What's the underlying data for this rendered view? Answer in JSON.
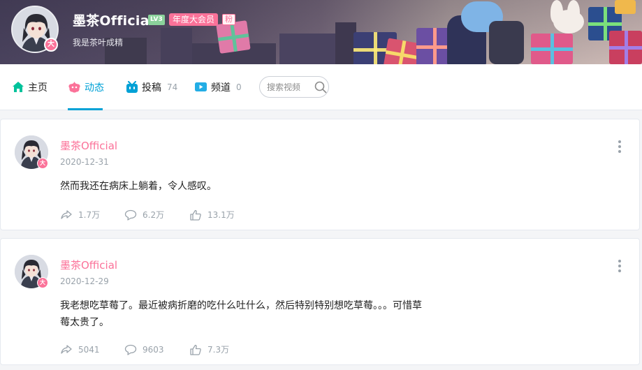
{
  "profile": {
    "name": "墨茶Official",
    "level": "LV3",
    "vip_label": "年度大会员",
    "fan_label": "粉",
    "sign": "我是茶叶成精",
    "avatar_badge": "大"
  },
  "nav": {
    "home": "主页",
    "dynamic": "动态",
    "posts": "投稿",
    "posts_count": "74",
    "channels": "频道",
    "channels_count": "0",
    "search_placeholder": "搜索视频"
  },
  "posts": [
    {
      "author": "墨茶Official",
      "date": "2020-12-31",
      "content": "然而我还在病床上躺着，令人感叹。",
      "share": "1.7万",
      "comment": "6.2万",
      "like": "13.1万"
    },
    {
      "author": "墨茶Official",
      "date": "2020-12-29",
      "content": "我老想吃草莓了。最近被病折磨的吃什么吐什么，然后特别特别想吃草莓。。。可惜草莓太贵了。",
      "share": "5041",
      "comment": "9603",
      "like": "7.3万"
    }
  ],
  "colors": {
    "brand_pink": "#fb7299",
    "accent_blue": "#00a1d6",
    "muted": "#99a2aa"
  },
  "icons": [
    "home-icon",
    "dynamic-icon",
    "posts-icon",
    "channels-icon",
    "search-icon",
    "share-icon",
    "comment-icon",
    "like-icon",
    "more-icon"
  ]
}
